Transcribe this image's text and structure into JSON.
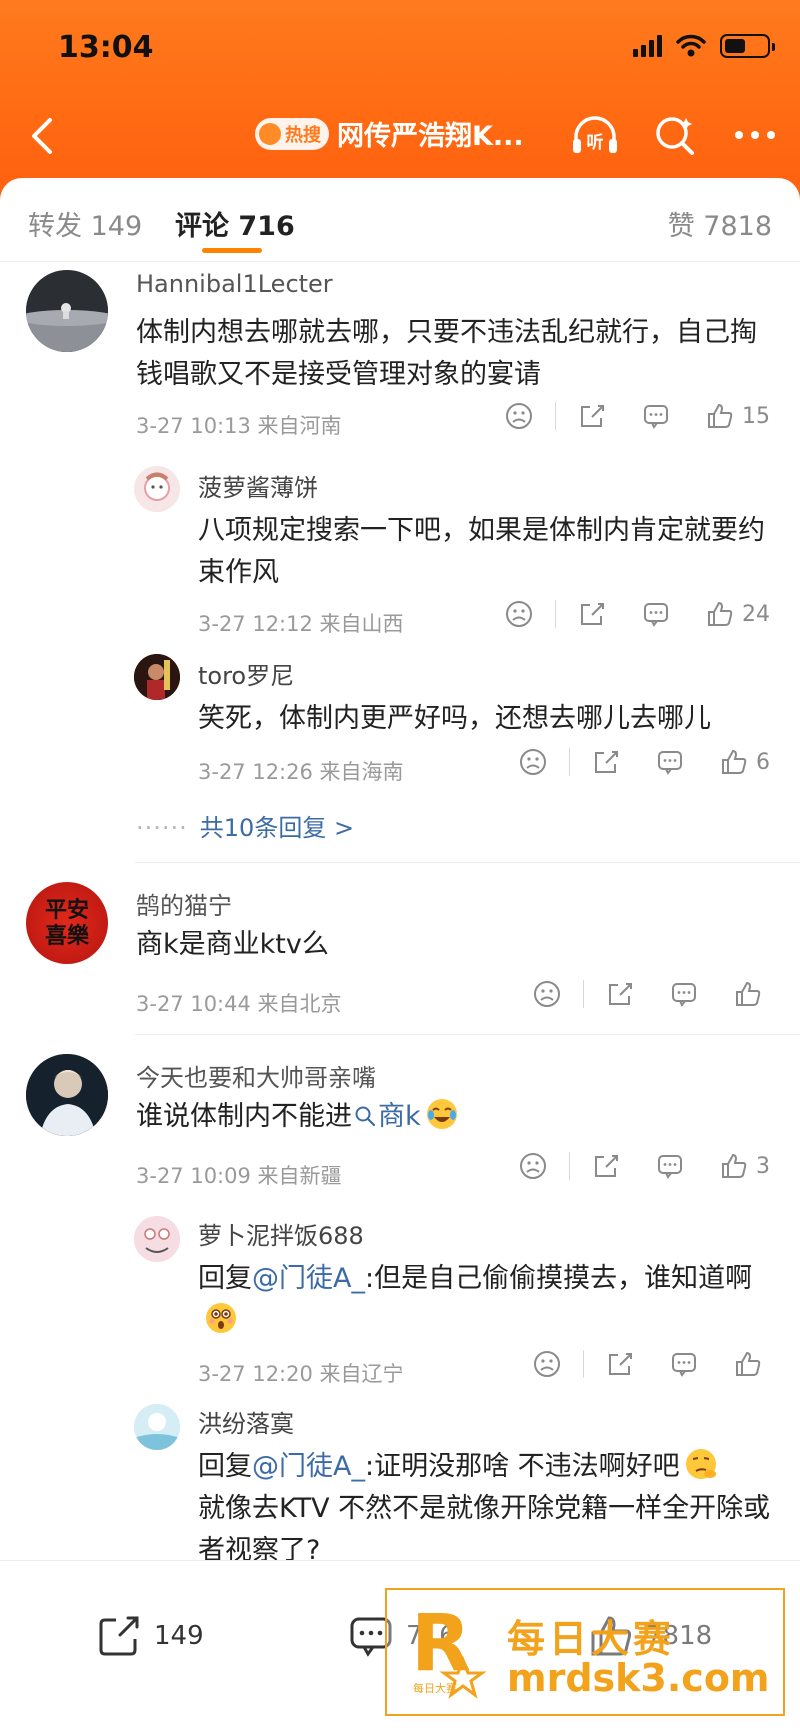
{
  "status": {
    "time": "13:04"
  },
  "nav": {
    "badge": "热搜",
    "title": "网传严浩翔K...",
    "listen": "听"
  },
  "tabs": {
    "repost": "转发 149",
    "comments": "评论 716",
    "likes": "赞 7818"
  },
  "comments": [
    {
      "user": "Hannibal1Lecter",
      "text": "体制内想去哪就去哪，只要不违法乱纪就行，自己掏钱唱歌又不是接受管理对象的宴请",
      "meta": "3-27 10:13 来自河南",
      "likes": "15",
      "replies": [
        {
          "user": "菠萝酱薄饼",
          "text": "八项规定搜索一下吧，如果是体制内肯定就要约束作风",
          "meta": "3-27 12:12 来自山西",
          "likes": "24"
        },
        {
          "user": "toro罗尼",
          "text": "笑死，体制内更严好吗，还想去哪儿去哪儿",
          "meta": "3-27 12:26 来自海南",
          "likes": "6"
        }
      ],
      "more": "共10条回复 >"
    },
    {
      "user": "鹄的猫宁",
      "text": "商k是商业ktv么",
      "meta": "3-27 10:44 来自北京",
      "likes": "",
      "avatar_text": "平安喜樂"
    },
    {
      "user": "今天也要和大帅哥亲嘴",
      "text_prefix": "谁说体制内不能进",
      "text_link": "商k",
      "meta": "3-27 10:09 来自新疆",
      "likes": "3",
      "replies": [
        {
          "user": "萝卜泥拌饭688",
          "reply_prefix": "回复",
          "mention": "@门徒A_",
          "text": ":但是自己偷偷摸摸去，谁知道啊",
          "meta": "3-27 12:20 来自辽宁",
          "likes": ""
        },
        {
          "user": "洪纷落寞",
          "reply_prefix": "回复",
          "mention": "@门徒A_",
          "text": ":证明没那啥 不违法啊好吧",
          "text2": "就像去KTV 不然不是就像开除党籍一样全开除或者视察了?"
        }
      ]
    }
  ],
  "bottom": {
    "repost": "149",
    "comment": "716",
    "like": "7818"
  },
  "watermark": {
    "line1": "每日大赛",
    "line2": "mrdsk3.com",
    "logo_letter": "R",
    "logo_small": "每日大赛"
  },
  "colors": {
    "accent": "#ff7a1e",
    "link": "#3c6ba6",
    "watermark": "#f2a21b"
  }
}
